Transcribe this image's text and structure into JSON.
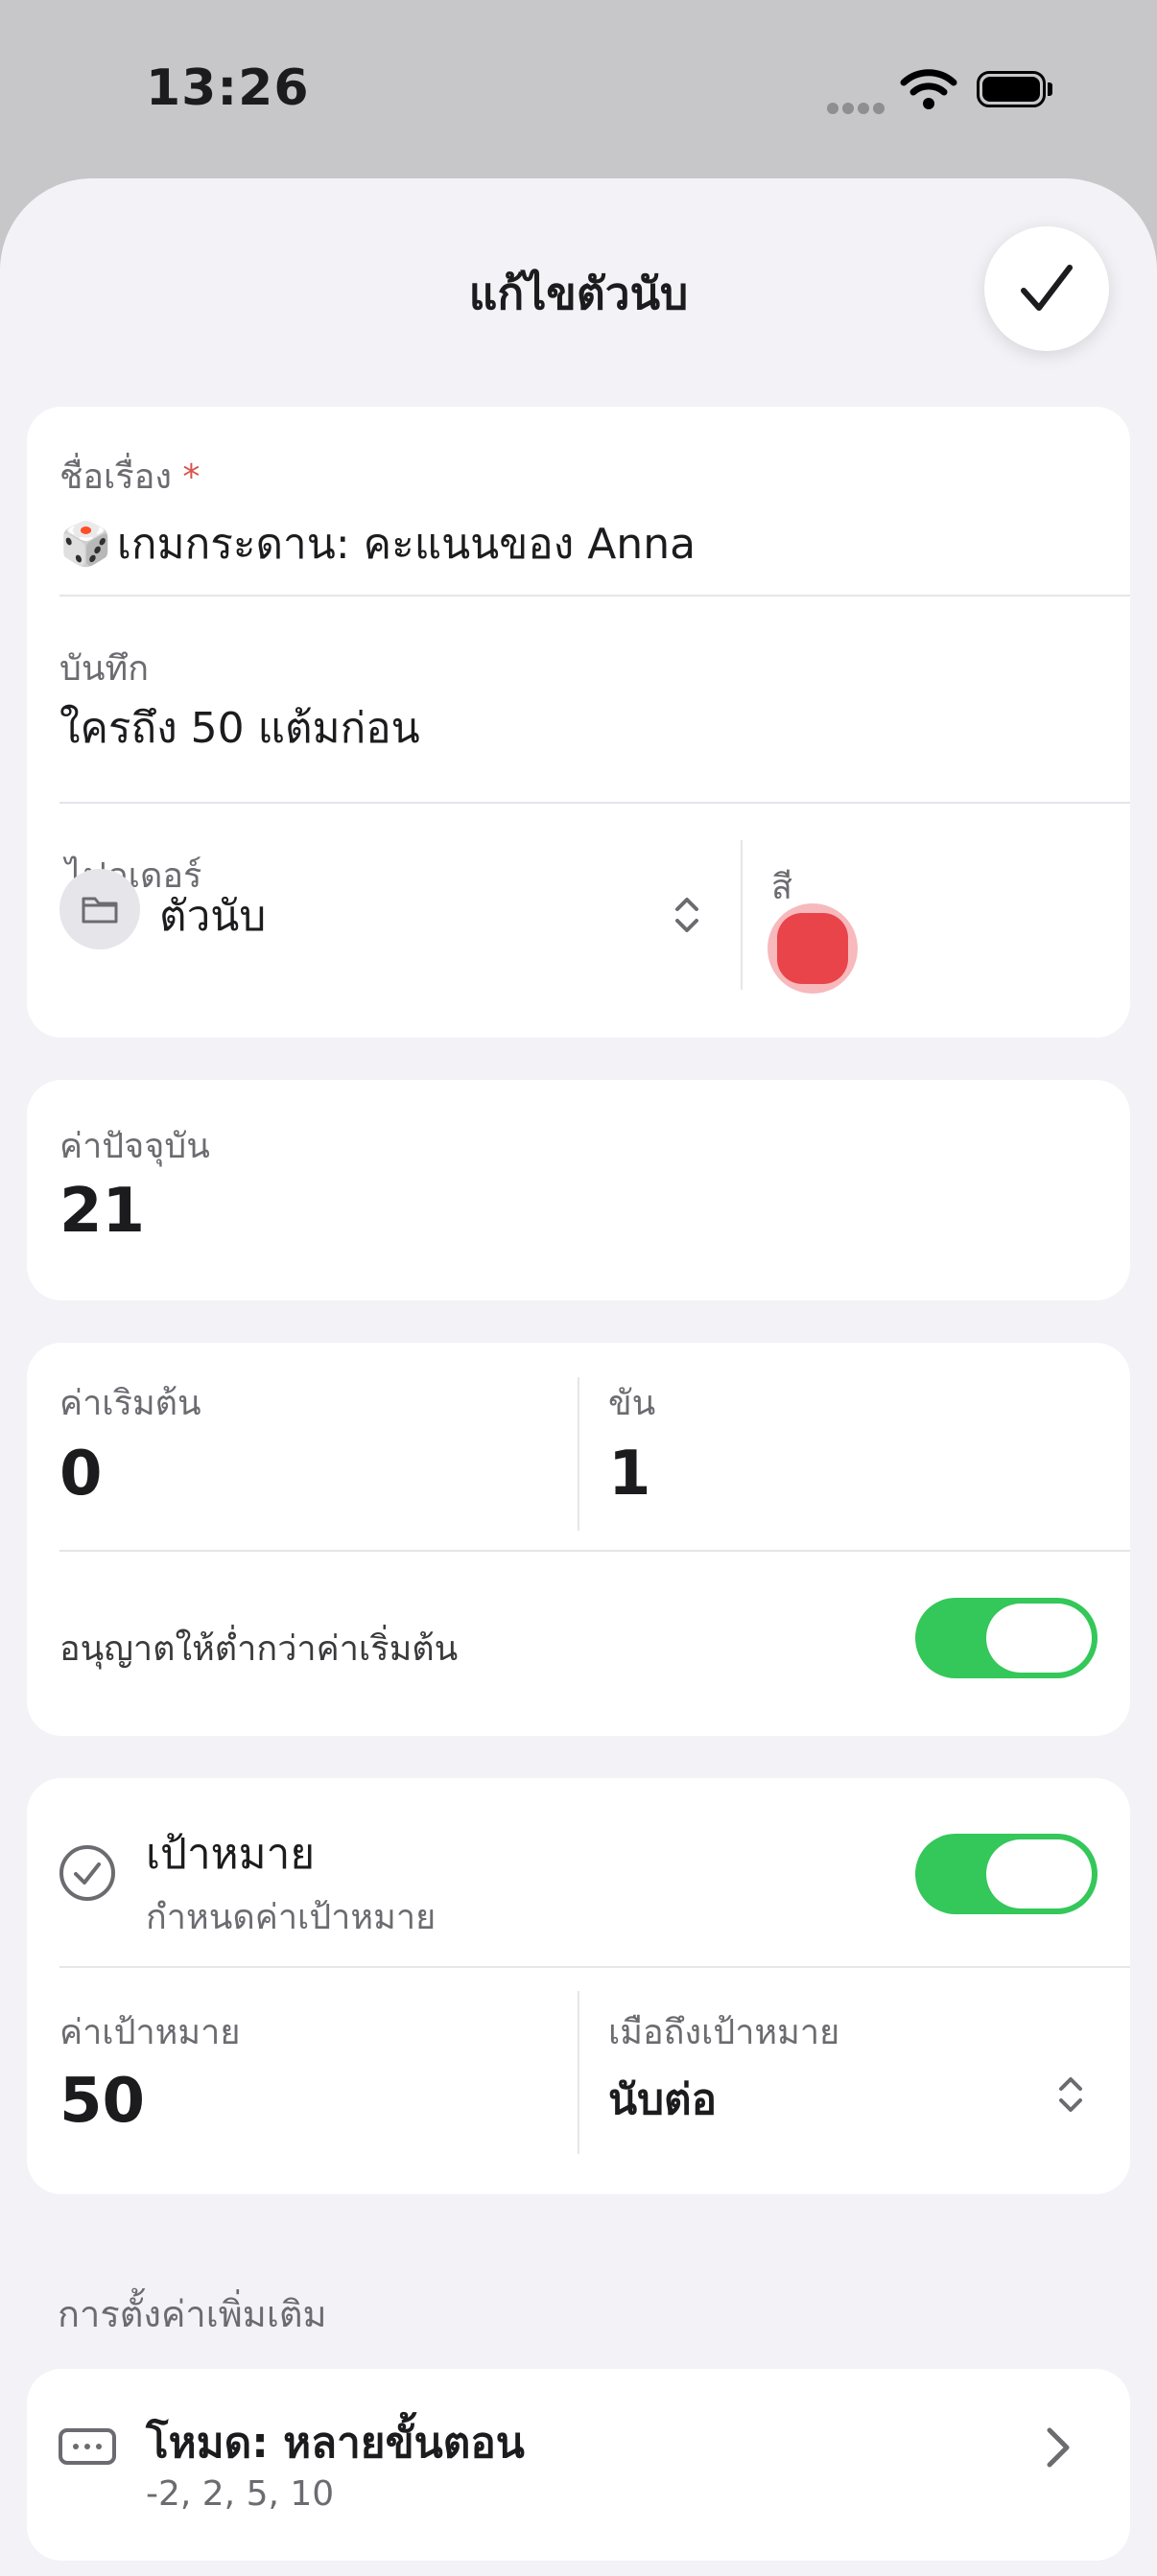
{
  "status_bar": {
    "time": "13:26"
  },
  "sheet": {
    "title": "แก้ไขตัวนับ"
  },
  "details": {
    "title_label": "ชื่อเรื่อง",
    "required_marker": "*",
    "title_emoji": "🎲",
    "title_value": "เกมกระดาน: คะแนนของ Anna",
    "note_label": "บันทึก",
    "note_value": "ใครถึง 50 แต้มก่อน",
    "folder_label": "ไฟลเดอร์",
    "folder_value": "ตัวนับ",
    "color_label": "สี",
    "color_value": "#e8444a"
  },
  "current": {
    "label": "ค่าปัจจุบัน",
    "value": "21"
  },
  "counter": {
    "start_label": "ค่าเริมต้น",
    "start_value": "0",
    "step_label": "ขัน",
    "step_value": "1",
    "allow_below_label": "อนุญาตให้ต่ำกว่าค่าเริ่มต้น",
    "allow_below_on": true
  },
  "goal": {
    "title": "เป้าหมาย",
    "subtitle": "กำหนดค่าเป้าหมาย",
    "enabled": true,
    "target_label": "ค่าเป้าหมาย",
    "target_value": "50",
    "on_reach_label": "เมือถึงเป้าหมาย",
    "on_reach_value": "นับต่อ"
  },
  "advanced": {
    "header": "การตั้งค่าเพิ่มเติม",
    "mode_title": "โหมด: หลายขั้นตอน",
    "mode_steps": "-2, 2, 5, 10"
  }
}
